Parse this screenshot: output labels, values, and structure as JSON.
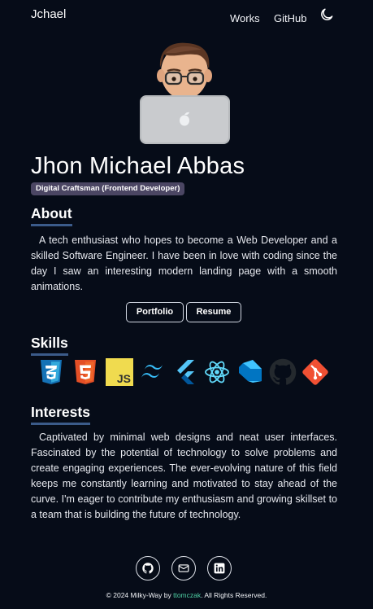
{
  "nav": {
    "brand": "Jchael",
    "links": [
      "Works",
      "GitHub"
    ],
    "theme_icon": "moon-icon"
  },
  "hero": {
    "avatar_icon": "memoji-with-laptop",
    "name": "Jhon Michael Abbas",
    "role_badge": "Digital Craftsman (Frontend Developer)"
  },
  "about": {
    "title": "About",
    "text": "A tech enthusiast who hopes to become a Web Developer and a skilled Software Engineer. I have been in love with coding since the day I saw an interesting modern landing page with a smooth animations.",
    "buttons": [
      "Portfolio",
      "Resume"
    ]
  },
  "skills": {
    "title": "Skills",
    "icons": [
      "css3-icon",
      "html5-icon",
      "javascript-icon",
      "tailwind-icon",
      "flutter-icon",
      "react-icon",
      "dart-icon",
      "github-icon",
      "git-icon"
    ]
  },
  "interests": {
    "title": "Interests",
    "text": "Captivated by minimal web designs and neat user interfaces. Fascinated by the potential of technology to solve problems and create engaging experiences. The ever-evolving nature of this field keeps me constantly learning and motivated to stay ahead of the curve. I'm eager to contribute my enthusiasm and growing skillset to a team that is building the future of technology."
  },
  "socials": [
    "github-icon",
    "mail-icon",
    "linkedin-icon"
  ],
  "footer": {
    "prefix": "© 2024 Milky-Way by ",
    "author": "ttomczak",
    "suffix": ". All Rights Reserved."
  },
  "colors": {
    "background": "#060c18",
    "badge": "#4b4663",
    "section_underline": "#3b5b8a",
    "footer_link": "#4fd1a5"
  }
}
